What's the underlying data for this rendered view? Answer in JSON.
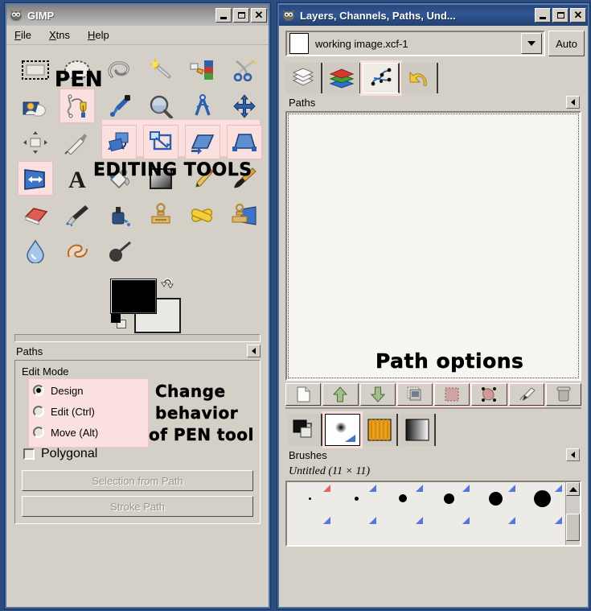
{
  "toolbox": {
    "title": "GIMP",
    "title_icon": "gimp-wilber-icon",
    "menus": [
      {
        "label": "File",
        "accel": "F"
      },
      {
        "label": "Xtns",
        "accel": "X"
      },
      {
        "label": "Help",
        "accel": "H"
      }
    ],
    "window_buttons": {
      "minimize": "minimize",
      "maximize": "maximize",
      "close": "close"
    },
    "tools": [
      {
        "name": "rect-select-tool",
        "row": 1,
        "selected": false
      },
      {
        "name": "ellipse-select-tool",
        "row": 1,
        "selected": false
      },
      {
        "name": "free-select-tool",
        "row": 1,
        "selected": false
      },
      {
        "name": "fuzzy-select-tool",
        "row": 1,
        "selected": false
      },
      {
        "name": "select-by-color-tool",
        "row": 1,
        "selected": false
      },
      {
        "name": "scissors-select-tool",
        "row": 1,
        "selected": false
      },
      {
        "name": "foreground-select-tool",
        "row": 2,
        "selected": false
      },
      {
        "name": "paths-tool",
        "row": 2,
        "selected": true
      },
      {
        "name": "color-picker-tool",
        "row": 2,
        "selected": false
      },
      {
        "name": "zoom-tool",
        "row": 2,
        "selected": false
      },
      {
        "name": "measure-tool",
        "row": 2,
        "selected": false
      },
      {
        "name": "move-tool",
        "row": 2,
        "selected": false
      },
      {
        "name": "align-tool",
        "row": 3,
        "selected": false
      },
      {
        "name": "crop-tool",
        "row": 3,
        "selected": false
      },
      {
        "name": "rotate-tool",
        "row": 3,
        "selected": true
      },
      {
        "name": "scale-tool",
        "row": 3,
        "selected": true
      },
      {
        "name": "shear-tool",
        "row": 3,
        "selected": true
      },
      {
        "name": "perspective-tool",
        "row": 3,
        "selected": true
      },
      {
        "name": "flip-tool",
        "row": 4,
        "selected": true
      },
      {
        "name": "text-tool",
        "row": 4,
        "selected": false
      },
      {
        "name": "bucket-fill-tool",
        "row": 4,
        "selected": false
      },
      {
        "name": "gradient-tool",
        "row": 4,
        "selected": false
      },
      {
        "name": "pencil-tool",
        "row": 4,
        "selected": false
      },
      {
        "name": "paintbrush-tool",
        "row": 4,
        "selected": false
      },
      {
        "name": "eraser-tool",
        "row": 5,
        "selected": false
      },
      {
        "name": "airbrush-tool",
        "row": 5,
        "selected": false
      },
      {
        "name": "ink-tool",
        "row": 5,
        "selected": false
      },
      {
        "name": "clone-tool",
        "row": 5,
        "selected": false
      },
      {
        "name": "heal-tool",
        "row": 5,
        "selected": false
      },
      {
        "name": "perspective-clone-tool",
        "row": 5,
        "selected": false
      },
      {
        "name": "blur-sharpen-tool",
        "row": 6,
        "selected": false
      },
      {
        "name": "smudge-tool",
        "row": 6,
        "selected": false
      },
      {
        "name": "dodge-burn-tool",
        "row": 6,
        "selected": false
      }
    ],
    "annotations": {
      "pen": "PEN",
      "editing_tools": "EDITING TOOLS",
      "change_behavior_line1": "Change",
      "change_behavior_line2": "behavior",
      "change_behavior_line3": "of PEN tool"
    },
    "colors": {
      "foreground": "#000000",
      "background": "#e8e8e4",
      "swap_icon": "swap-colors-icon",
      "reset_icon": "reset-colors-icon"
    },
    "tool_options": {
      "header": "Paths",
      "menu_icon": "tab-menu-triangle-icon",
      "group_label": "Edit Mode",
      "radios": [
        {
          "label": "Design",
          "selected": true
        },
        {
          "label": "Edit (Ctrl)",
          "selected": false
        },
        {
          "label": "Move (Alt)",
          "selected": false
        }
      ],
      "checkbox": {
        "label": "Polygonal",
        "checked": false
      },
      "buttons": [
        {
          "label": "Selection from Path",
          "enabled": false
        },
        {
          "label": "Stroke Path",
          "enabled": false
        }
      ]
    }
  },
  "dock": {
    "title": "Layers, Channels, Paths, Und...",
    "title_icon": "gimp-wilber-icon",
    "window_buttons": {
      "minimize": "minimize",
      "maximize": "maximize",
      "close": "close"
    },
    "image_selector": {
      "value": "working image.xcf-1",
      "thumbnail": "image-thumbnail",
      "dropdown_icon": "chevron-down-icon"
    },
    "auto_button": "Auto",
    "tabs": [
      {
        "name": "tab-layers",
        "active": false
      },
      {
        "name": "tab-channels",
        "active": false
      },
      {
        "name": "tab-paths",
        "active": true
      },
      {
        "name": "tab-undo-history",
        "active": false
      }
    ],
    "paths_panel": {
      "header": "Paths",
      "menu_icon": "tab-menu-triangle-icon",
      "empty": true,
      "annotation": "Path options",
      "buttons": [
        {
          "name": "new-path-button",
          "highlighted": false
        },
        {
          "name": "raise-path-button",
          "highlighted": false
        },
        {
          "name": "lower-path-button",
          "highlighted": false
        },
        {
          "name": "duplicate-path-button",
          "highlighted": true
        },
        {
          "name": "path-to-selection-button",
          "highlighted": true
        },
        {
          "name": "selection-to-path-button",
          "highlighted": true
        },
        {
          "name": "stroke-path-button",
          "highlighted": true
        },
        {
          "name": "delete-path-button",
          "highlighted": false
        }
      ]
    },
    "brush_dock": {
      "tabs": [
        {
          "name": "tab-colors",
          "active": false
        },
        {
          "name": "tab-brushes",
          "active": true
        },
        {
          "name": "tab-patterns",
          "active": false
        },
        {
          "name": "tab-gradients",
          "active": false
        }
      ],
      "header": "Brushes",
      "menu_icon": "tab-menu-triangle-icon",
      "selected_brush": "Untitled (11 × 11)",
      "grid": [
        {
          "size": 3,
          "marker": "red"
        },
        {
          "size": 5,
          "marker": "blue"
        },
        {
          "size": 9,
          "marker": "blue"
        },
        {
          "size": 13,
          "marker": "blue"
        },
        {
          "size": 17,
          "marker": "blue"
        },
        {
          "size": 21,
          "marker": "blue"
        },
        {
          "size": 0,
          "marker": "blue"
        },
        {
          "size": 0,
          "marker": "blue"
        },
        {
          "size": 0,
          "marker": "blue"
        },
        {
          "size": 0,
          "marker": "blue"
        },
        {
          "size": 0,
          "marker": "blue"
        },
        {
          "size": 0,
          "marker": "blue"
        }
      ],
      "scrollbar": {
        "up_icon": "scroll-up-arrow-icon"
      }
    }
  }
}
